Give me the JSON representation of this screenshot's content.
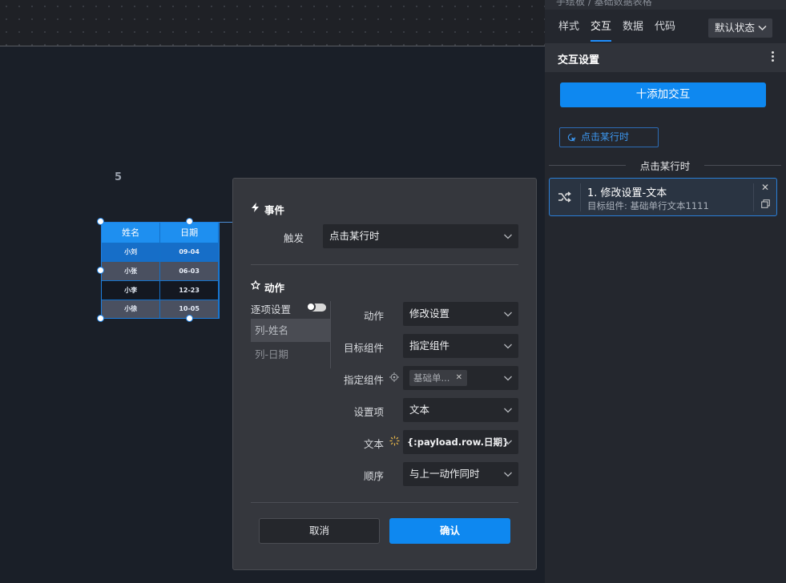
{
  "canvas": {
    "number_label": "5",
    "table": {
      "headers": [
        "姓名",
        "日期"
      ],
      "rows": [
        {
          "name": "小刘",
          "date": "09-04"
        },
        {
          "name": "小张",
          "date": "06-03"
        },
        {
          "name": "小李",
          "date": "12-23"
        },
        {
          "name": "小徐",
          "date": "10-05"
        }
      ]
    }
  },
  "right_panel": {
    "breadcrumb": "手绘板 / 基础数据表格",
    "tabs": [
      {
        "label": "样式",
        "active": false
      },
      {
        "label": "交互",
        "active": true
      },
      {
        "label": "数据",
        "active": false
      },
      {
        "label": "代码",
        "active": false
      }
    ],
    "state_select": "默认状态",
    "section_title": "交互设置",
    "add_button": "十添加交互",
    "event_tag": "点击某行时",
    "divider_label": "点击某行时",
    "action_card": {
      "title": "1. 修改设置-文本",
      "subtitle": "目标组件: 基础单行文本1111"
    }
  },
  "modal": {
    "event_section": "事件",
    "trigger_label": "触发",
    "trigger_value": "点击某行时",
    "action_section": "动作",
    "per_item_label": "逐项设置",
    "list_items": [
      "列-姓名",
      "列-日期"
    ],
    "fields": {
      "action": {
        "label": "动作",
        "value": "修改设置"
      },
      "target": {
        "label": "目标组件",
        "value": "指定组件"
      },
      "specified": {
        "label": "指定组件",
        "chip": "基础单..."
      },
      "setting": {
        "label": "设置项",
        "value": "文本"
      },
      "text": {
        "label": "文本",
        "value": "{:payload.row.日期}"
      },
      "order": {
        "label": "顺序",
        "value": "与上一动作同时"
      }
    },
    "cancel_button": "取消",
    "ok_button": "确认"
  },
  "colors": {
    "accent": "#0e88f0",
    "panel_bg": "#24272e",
    "modal_bg": "#35373d",
    "canvas_bg": "#1a1f28"
  }
}
